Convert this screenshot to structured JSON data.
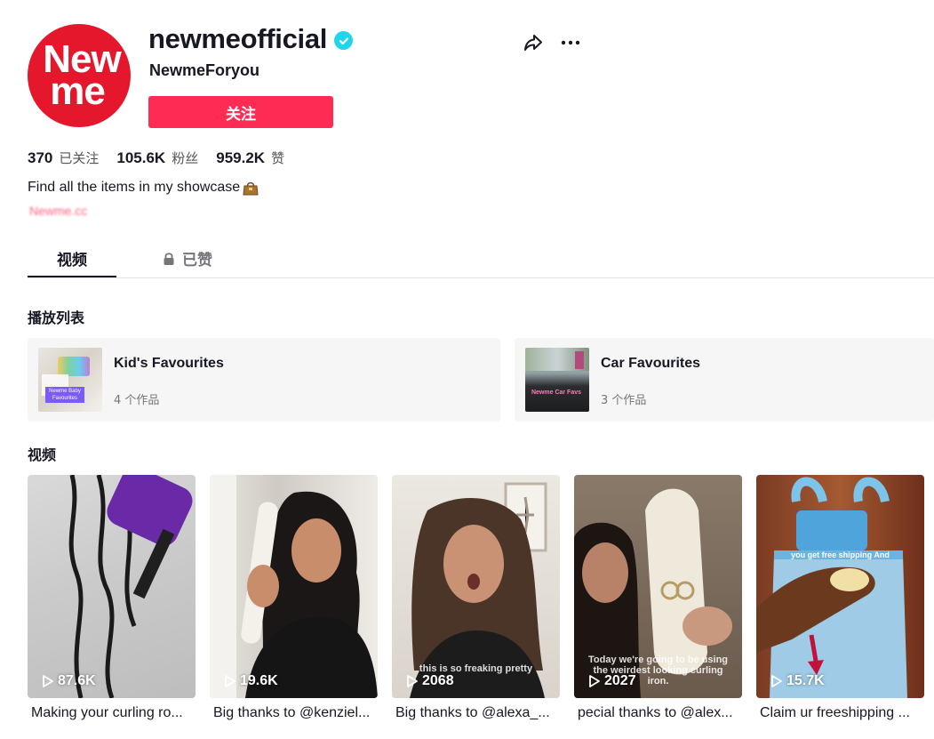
{
  "profile": {
    "avatar_line1": "New",
    "avatar_line2": "me",
    "username": "newmeofficial",
    "nickname": "NewmeForyou",
    "follow_label": "关注",
    "bio": "Find all the items in my showcase",
    "link": "Newme.cc",
    "stats": [
      {
        "value": "370",
        "label": "已关注"
      },
      {
        "value": "105.6K",
        "label": "粉丝"
      },
      {
        "value": "959.2K",
        "label": "赞"
      }
    ]
  },
  "tabs": [
    {
      "label": "视频",
      "active": true
    },
    {
      "label": "已赞",
      "active": false
    }
  ],
  "playlists_title": "播放列表",
  "playlists": [
    {
      "title": "Kid's Favourites",
      "count": "4 个作品",
      "thumb_text": "Newme Baby Favourites"
    },
    {
      "title": "Car Favourites",
      "count": "3 个作品",
      "thumb_text": "Newme Car Favs"
    }
  ],
  "videos_title": "视频",
  "videos": [
    {
      "views": "87.6K",
      "caption": "Making your curling ro...",
      "overlay": ""
    },
    {
      "views": "19.6K",
      "caption": "Big thanks to @kenziel...",
      "overlay": ""
    },
    {
      "views": "2068",
      "caption": "Big thanks to @alexa_...",
      "overlay": "this is so freaking pretty"
    },
    {
      "views": "2027",
      "caption": "pecial thanks to @alex...",
      "overlay": "Today we're going to be using the weirdest looking curling iron."
    },
    {
      "views": "15.7K",
      "caption": "Claim ur freeshipping ...",
      "overlay": "you get free shipping And"
    }
  ],
  "colors": {
    "accent": "#fe2c55",
    "verified": "#20d5ec",
    "text": "#161823",
    "muted": "#75767c"
  }
}
